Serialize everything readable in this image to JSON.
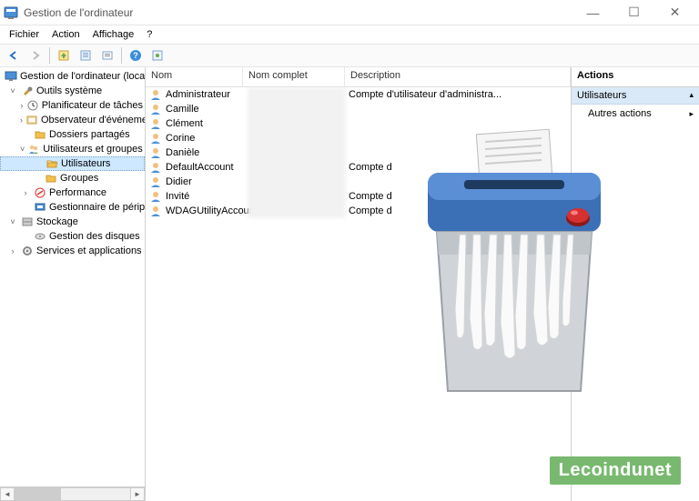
{
  "window": {
    "title": "Gestion de l'ordinateur"
  },
  "menu": {
    "file": "Fichier",
    "action": "Action",
    "view": "Affichage",
    "help": "?"
  },
  "tree": {
    "root": "Gestion de l'ordinateur (local)",
    "system_tools": "Outils système",
    "task_scheduler": "Planificateur de tâches",
    "event_viewer": "Observateur d'événements",
    "shared_folders": "Dossiers partagés",
    "users_groups": "Utilisateurs et groupes locaux",
    "users": "Utilisateurs",
    "groups": "Groupes",
    "performance": "Performance",
    "device_manager": "Gestionnaire de périphériques",
    "storage": "Stockage",
    "disk_mgmt": "Gestion des disques",
    "services_apps": "Services et applications"
  },
  "columns": {
    "name": "Nom",
    "fullname": "Nom complet",
    "description": "Description"
  },
  "users": [
    {
      "name": "Administrateur",
      "desc": "Compte d'utilisateur d'administra..."
    },
    {
      "name": "Camille",
      "desc": ""
    },
    {
      "name": "Clément",
      "desc": ""
    },
    {
      "name": "Corine",
      "desc": ""
    },
    {
      "name": "Danièle",
      "desc": ""
    },
    {
      "name": "DefaultAccount",
      "desc": "Compte d"
    },
    {
      "name": "Didier",
      "desc": ""
    },
    {
      "name": "Invité",
      "desc": "Compte d"
    },
    {
      "name": "WDAGUtilityAccount",
      "desc": "Compte d"
    }
  ],
  "actions": {
    "header": "Actions",
    "group": "Utilisateurs",
    "more": "Autres actions"
  },
  "watermark": "Lecoindunet"
}
